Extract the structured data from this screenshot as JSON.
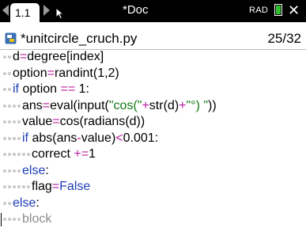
{
  "tab": {
    "label": "1.1"
  },
  "title_bar": {
    "document_title": "*Doc",
    "angle_mode": "RAD"
  },
  "file": {
    "name": "*unitcircle_cruch.py",
    "position": "25/32"
  },
  "code_lines": [
    {
      "indent": 1,
      "text": "d=degree[index]"
    },
    {
      "indent": 1,
      "text": "option=randint(1,2)"
    },
    {
      "indent": 1,
      "text": "if option == 1:"
    },
    {
      "indent": 2,
      "text": "ans=eval(input(\"cos(\"+str(d)+\"°) \"))"
    },
    {
      "indent": 2,
      "text": "value=cos(radians(d))"
    },
    {
      "indent": 2,
      "text": "if abs(ans-value)<0.001:"
    },
    {
      "indent": 3,
      "text": "correct +=1"
    },
    {
      "indent": 2,
      "text": "else:"
    },
    {
      "indent": 3,
      "text": "flag=False"
    },
    {
      "indent": 1,
      "text": "else:"
    },
    {
      "indent": 2,
      "text": "block"
    }
  ],
  "colors": {
    "keyword": "#1e3db8",
    "operator": "#b8219e",
    "string": "#117a11",
    "titlebar": "#000000",
    "battery": "#2fbf2f"
  }
}
